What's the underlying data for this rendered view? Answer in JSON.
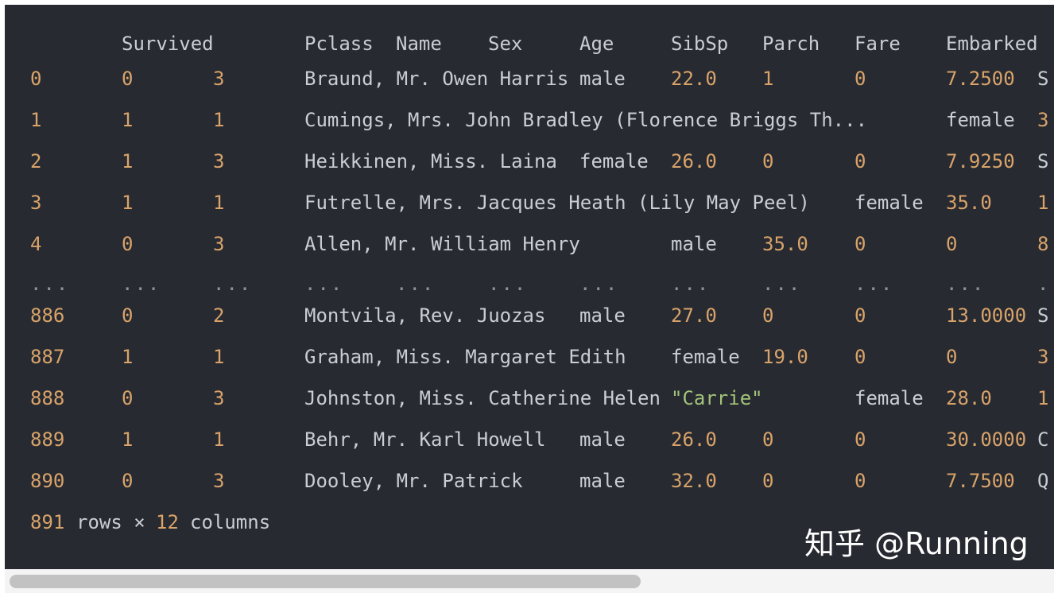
{
  "table": {
    "headers": [
      "Survived",
      "Pclass",
      "Name",
      "Sex",
      "Age",
      "SibSp",
      "Parch",
      "Fare",
      "Embarked"
    ],
    "rows": [
      {
        "c0": "0",
        "c1": "0",
        "c2": "3",
        "c3": "Braund, Mr. Owen Harris",
        "c4": "male",
        "c5": "22.0",
        "c6": "1",
        "c7": "0",
        "c8": "7.2500",
        "c9": "S"
      },
      {
        "c0": "1",
        "c1": "1",
        "c2": "1",
        "c3": "Cumings, Mrs. John Bradley (Florence Briggs Th...",
        "c8": "female",
        "c9": "3"
      },
      {
        "c0": "2",
        "c1": "1",
        "c2": "3",
        "c3": "Heikkinen, Miss. Laina",
        "c4": "female",
        "c5": "26.0",
        "c6": "0",
        "c7": "0",
        "c8": "7.9250",
        "c9": "S"
      },
      {
        "c0": "3",
        "c1": "1",
        "c2": "1",
        "c3": "Futrelle, Mrs. Jacques Heath (Lily May Peel)",
        "c7": "female",
        "c8": "35.0",
        "c9": "1"
      },
      {
        "c0": "4",
        "c1": "0",
        "c2": "3",
        "c3": "Allen, Mr. William Henry",
        "c4": "male",
        "c5": "35.0",
        "c6": "0",
        "c7": "0",
        "c8": "8"
      },
      {
        "ellipsis": "...",
        "tail": "."
      },
      {
        "c0": "886",
        "c1": "0",
        "c2": "2",
        "c3": "Montvila, Rev. Juozas",
        "c4": "male",
        "c5": "27.0",
        "c6": "0",
        "c7": "0",
        "c8": "13.0000",
        "c9": "S"
      },
      {
        "c0": "887",
        "c1": "1",
        "c2": "1",
        "c3": "Graham, Miss. Margaret Edith",
        "c4": "female",
        "c5": "19.0",
        "c6": "0",
        "c7": "0",
        "c8": "3"
      },
      {
        "c0": "888",
        "c1": "0",
        "c2": "3",
        "c3": "Johnston, Miss. Catherine Helen",
        "c4": "\"Carrie\"",
        "c7": "female",
        "c8": "28.0",
        "c9": "1"
      },
      {
        "c0": "889",
        "c1": "1",
        "c2": "1",
        "c3": "Behr, Mr. Karl Howell",
        "c4": "male",
        "c5": "26.0",
        "c6": "0",
        "c7": "0",
        "c8": "30.0000",
        "c9": "C"
      },
      {
        "c0": "890",
        "c1": "0",
        "c2": "3",
        "c3": "Dooley, Mr. Patrick",
        "c4": "male",
        "c5": "32.0",
        "c6": "0",
        "c7": "0",
        "c8": "7.7500",
        "c9": "Q"
      }
    ],
    "footer": {
      "rows_count": "891",
      "rows_word": "rows ×",
      "cols_count": "12",
      "cols_word": "columns"
    }
  },
  "watermark": "知乎 @Running",
  "colors": {
    "background": "#272a31",
    "number": "#d9a36a",
    "text": "#c9cdd4",
    "string": "#a3c47a"
  }
}
